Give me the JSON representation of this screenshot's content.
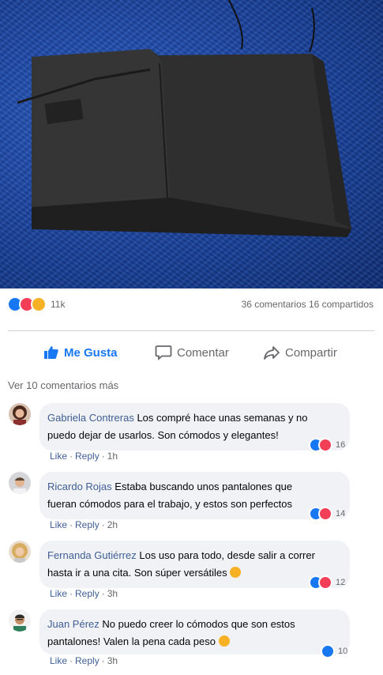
{
  "post": {
    "reaction_count": "11k",
    "comments_shares": "36 comentarios 16 compartidos"
  },
  "actions": {
    "like": "Me Gusta",
    "comment": "Comentar",
    "share": "Compartir"
  },
  "more_comments": "Ver 10 comentarios más",
  "comments": [
    {
      "name": "Gabriela Contreras",
      "text_line1": "Los compré hace unas semanas y no",
      "text_line2": "puedo dejar de usarlos. Son cómodos y elegantes!",
      "like": "Like",
      "reply": "Reply",
      "time": "1h",
      "reactions": "16"
    },
    {
      "name": "Ricardo Rojas",
      "text_line1": "Estaba buscando unos pantalones que",
      "text_line2": "fueran cómodos para el trabajo, y estos son perfectos",
      "like": "Like",
      "reply": "Reply",
      "time": "2h",
      "reactions": "14"
    },
    {
      "name": "Fernanda Gutiérrez",
      "text_line1": "Los uso para todo, desde salir a correr",
      "text_line2": "hasta ir a una cita. Son súper versátiles",
      "like": "Like",
      "reply": "Reply",
      "time": "3h",
      "reactions": "12"
    },
    {
      "name": "Juan Pérez",
      "text_line1": "No puedo creer lo cómodos que son estos",
      "text_line2": "pantalones! Valen la pena cada peso",
      "like": "Like",
      "reply": "Reply",
      "time": "3h",
      "reactions": "10"
    }
  ],
  "icons": {
    "like": "thumbs-up-icon",
    "comment": "speech-bubble-icon",
    "share": "share-arrow-icon"
  },
  "colors": {
    "accent": "#1877f2",
    "love": "#f33e58",
    "haha": "#f7b125",
    "name": "#3f5e95"
  }
}
